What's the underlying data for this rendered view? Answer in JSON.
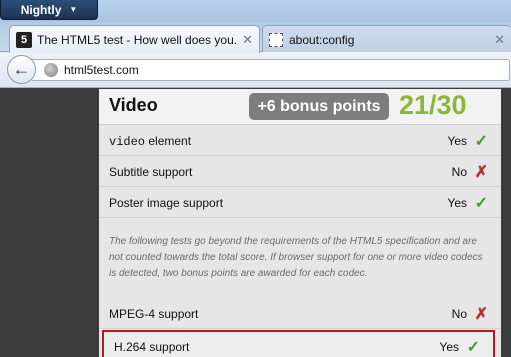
{
  "app_menu": {
    "label": "Nightly"
  },
  "tabs": [
    {
      "title": "The HTML5 test - How well does you...",
      "favicon": "html5-logo-icon",
      "favicon_text": "5",
      "active": true
    },
    {
      "title": "about:config",
      "favicon": "blank-page-icon",
      "active": false
    }
  ],
  "navbar": {
    "url": "html5test.com"
  },
  "section": {
    "title": "Video",
    "bonus": "+6 bonus points",
    "score": "21/30"
  },
  "rows": [
    {
      "label_code": "video",
      "label_rest": " element",
      "value": "Yes",
      "mark": "✓",
      "result": "pass"
    },
    {
      "label": "Subtitle support",
      "value": "No",
      "mark": "✗",
      "result": "fail"
    },
    {
      "label": "Poster image support",
      "value": "Yes",
      "mark": "✓",
      "result": "pass"
    },
    {
      "label": "MPEG-4 support",
      "value": "No",
      "mark": "✗",
      "result": "fail"
    },
    {
      "label": "H.264 support",
      "value": "Yes",
      "mark": "✓",
      "result": "pass"
    }
  ],
  "note": "The following tests go beyond the requirements of the HTML5 specification and are not counted towards the total score. If browser support for one or more video codecs is detected, two bonus points are awarded for each codec.",
  "colors": {
    "pass": "#4a9a32",
    "fail": "#b23030",
    "score": "#8db53c",
    "highlight": "#b01c1c"
  }
}
